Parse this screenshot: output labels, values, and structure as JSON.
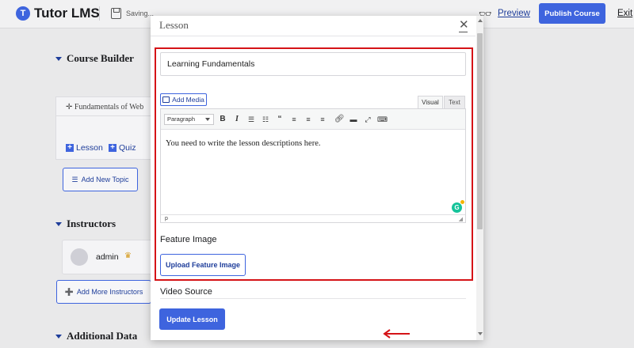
{
  "header": {
    "logo_mark": "T",
    "logo_text": "Tutor LMS",
    "save_status": "Saving...",
    "preview_label": "Preview",
    "publish_label": "Publish Course",
    "exit_label": "Exit"
  },
  "background": {
    "course_builder_heading": "Course Builder",
    "topic_title": "Fundamentals of Web",
    "lesson_link": "Lesson",
    "quiz_link": "Quiz",
    "add_topic_label": "Add New Topic",
    "instructors_heading": "Instructors",
    "instructor_name": "admin",
    "add_instructors_label": "Add More Instructors",
    "additional_data_heading": "Additional Data"
  },
  "modal": {
    "title": "Lesson",
    "lesson_name": "Learning Fundamentals",
    "add_media_label": "Add Media",
    "tab_visual": "Visual",
    "tab_text": "Text",
    "paragraph_format": "Paragraph",
    "editor_content": "You need to write the lesson descriptions here.",
    "status_path": "p",
    "feature_image_label": "Feature Image",
    "upload_label": "Upload Feature Image",
    "video_source_label": "Video Source",
    "update_label": "Update Lesson"
  },
  "toolbar_icons": [
    "bold-icon",
    "italic-icon",
    "bullet-list-icon",
    "numbered-list-icon",
    "blockquote-icon",
    "align-left-icon",
    "align-center-icon",
    "align-right-icon",
    "link-icon",
    "horizontal-line-icon",
    "fullscreen-icon",
    "kitchen-sink-icon"
  ],
  "colors": {
    "accent": "#3e64de",
    "highlight": "#d51317",
    "arrow": "#d51317"
  }
}
